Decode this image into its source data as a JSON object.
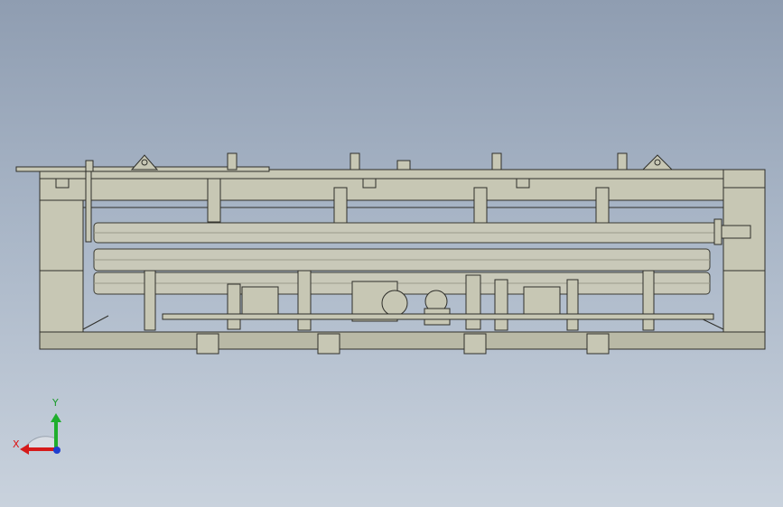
{
  "colors": {
    "frame": "#c7c7b4",
    "frame_dark": "#a8a896",
    "pipe": "#c9c9b9",
    "pipe_edge": "#3a3a32",
    "line": "#2f2f2a",
    "x_axis": "#d61a1a",
    "y_axis": "#1fae2d",
    "z_axis": "#1f3fcf"
  },
  "triad": {
    "x_label": "X",
    "y_label": "Y"
  }
}
